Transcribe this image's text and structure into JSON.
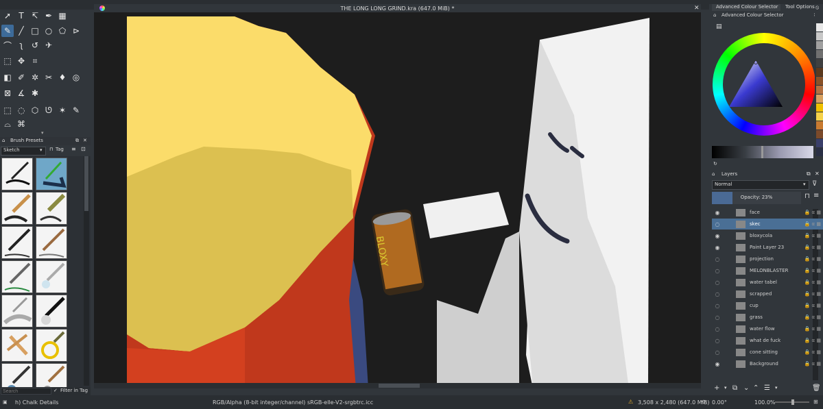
{
  "document": {
    "title": "THE LONG LONG GRIND.kra (647.0 MiB) *"
  },
  "toolbox": {
    "tools": [
      "select-shapes",
      "text",
      "edit-shapes",
      "calligraphy",
      "gradient-tool",
      "freehand-brush",
      "line",
      "rectangle",
      "ellipse",
      "polygon",
      "polyline",
      "bezier-curve",
      "dynamic-brush",
      "freehand-path",
      "multibrush",
      "transform",
      "move",
      "crop",
      "gradient",
      "color-picker",
      "smart-patch",
      "fill",
      "enclose-fill",
      "assistant",
      "measure",
      "reference-images",
      "rect-select",
      "ellipse-select",
      "polygon-select",
      "freehand-select",
      "contiguous-select",
      "similar-select",
      "bezier-select",
      "magnetic-select"
    ]
  },
  "brush_presets": {
    "title": "Brush Presets",
    "tag_value": "Sketch",
    "tag_button": "Tag",
    "search_placeholder": "Search",
    "filter_label": "Filter in Tag",
    "current_preset": "h) Chalk Details"
  },
  "colour": {
    "tab_advanced": "Advanced Colour Selector",
    "tab_tool": "Tool Options",
    "panel_title": "Advanced Colour Selector",
    "swatches": [
      "#e8e8e8",
      "#c8c8c8",
      "#a0a0a0",
      "#707070",
      "#404040",
      "#5c3a1e",
      "#8a5228",
      "#b37040",
      "#d8a060",
      "#f0c000",
      "#f6d24a",
      "#c87a30",
      "#7b4a2a",
      "#3a3f6a",
      "#2a2f45"
    ]
  },
  "layers": {
    "title": "Layers",
    "blend_mode": "Normal",
    "opacity_label": "Opacity:  23%",
    "items": [
      {
        "name": "face",
        "visible": true,
        "selected": false
      },
      {
        "name": "skec",
        "visible": false,
        "selected": true
      },
      {
        "name": "bloxycola",
        "visible": true,
        "selected": false
      },
      {
        "name": "Paint Layer 23",
        "visible": true,
        "selected": false
      },
      {
        "name": "projection",
        "visible": false,
        "selected": false
      },
      {
        "name": "MELONBLASTER",
        "visible": false,
        "selected": false
      },
      {
        "name": "water tabel",
        "visible": false,
        "selected": false
      },
      {
        "name": "scrapped",
        "visible": false,
        "selected": false
      },
      {
        "name": "cup",
        "visible": false,
        "selected": false
      },
      {
        "name": "grass",
        "visible": false,
        "selected": false
      },
      {
        "name": "water flow",
        "visible": false,
        "selected": false
      },
      {
        "name": "what de fuck",
        "visible": false,
        "selected": false
      },
      {
        "name": "cone sitting",
        "visible": false,
        "selected": false
      },
      {
        "name": "Background",
        "visible": true,
        "selected": false
      }
    ]
  },
  "status": {
    "color_space": "RGB/Alpha (8-bit integer/channel)  sRGB-elle-V2-srgbtrc.icc",
    "dimensions": "3,508 x 2,480 (647.0 MiB)",
    "rotation": "0.00°",
    "zoom": "100.0%"
  },
  "artwork": {
    "can_text": "BLOXY"
  }
}
